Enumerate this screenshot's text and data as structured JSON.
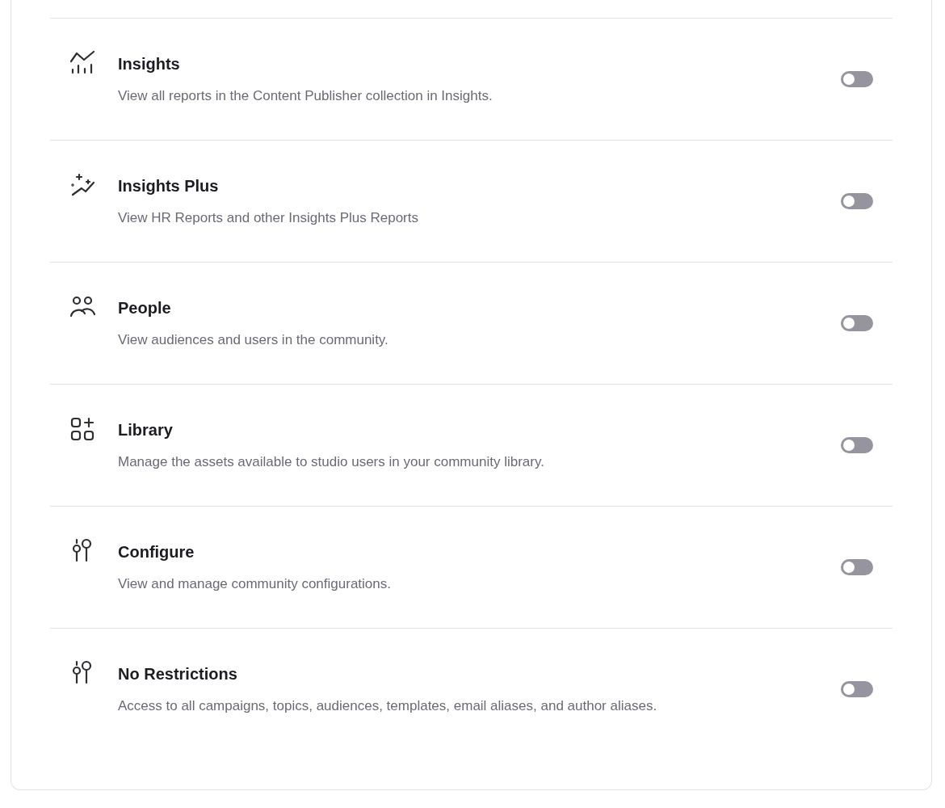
{
  "permissions": [
    {
      "kind": "insights",
      "title": "Insights",
      "description": "View all reports in the Content Publisher collection in Insights.",
      "on": false
    },
    {
      "kind": "insights_plus",
      "title": "Insights Plus",
      "description": "View HR Reports and other Insights Plus Reports",
      "on": false
    },
    {
      "kind": "people",
      "title": "People",
      "description": "View audiences and users in the community.",
      "on": false
    },
    {
      "kind": "library",
      "title": "Library",
      "description": "Manage the assets available to studio users in your community library.",
      "on": false
    },
    {
      "kind": "configure",
      "title": "Configure",
      "description": "View and manage community configurations.",
      "on": false
    },
    {
      "kind": "configure",
      "title": "No Restrictions",
      "description": "Access to all campaigns, topics, audiences, templates, email aliases, and author aliases.",
      "on": false
    }
  ]
}
